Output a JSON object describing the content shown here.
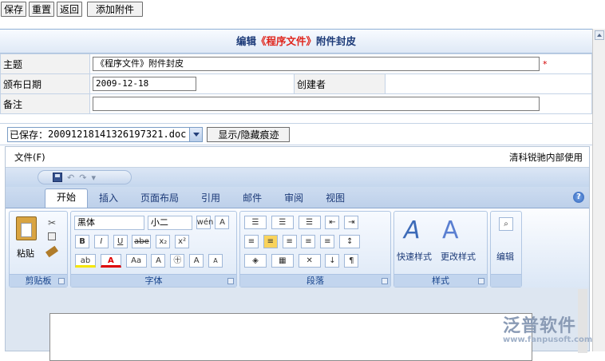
{
  "toolbar": {
    "save": "保存",
    "reset": "重置",
    "back": "返回",
    "attach": "添加附件"
  },
  "header": {
    "title_pre": "编辑",
    "title_hl": "《程序文件》",
    "title_post": "附件封皮"
  },
  "form": {
    "subject_label": "主题",
    "subject_value": "《程序文件》附件封皮",
    "required_mark": "*",
    "date_label": "颁布日期",
    "date_value": "2009-12-18",
    "creator_label": "创建者",
    "creator_value": "",
    "note_label": "备注",
    "note_value": ""
  },
  "saved": {
    "label": "已保存：",
    "file": "20091218141326197321.doc",
    "toggle_label": "显示/隐藏痕迹"
  },
  "doc": {
    "menu_file": "文件(F)",
    "menu_right": "清科锐驰内部使用",
    "qat_undo": "↶",
    "qat_redo": "↷",
    "qat_more": "▾",
    "tabs": [
      {
        "label": "开始"
      },
      {
        "label": "插入"
      },
      {
        "label": "页面布局"
      },
      {
        "label": "引用"
      },
      {
        "label": "邮件"
      },
      {
        "label": "审阅"
      },
      {
        "label": "视图"
      }
    ],
    "help": "?",
    "groups": {
      "clipboard": {
        "label": "剪贴板",
        "paste": "粘贴"
      },
      "font": {
        "label": "字体",
        "font_name": "黑体",
        "font_size": "小二",
        "b": "B",
        "i": "I",
        "u": "U",
        "strike": "abe",
        "sub": "x₂",
        "sup": "x²",
        "aa": "Aa",
        "grow": "A",
        "shrink": "A",
        "phon": "wén",
        "box": "A",
        "circle": "㊉",
        "highlight": "ab",
        "color": "A"
      },
      "paragraph": {
        "label": "段落"
      },
      "styles": {
        "label": "样式",
        "quick": "快速样式",
        "change": "更改样式"
      },
      "editing": {
        "label": "",
        "edit": "编辑"
      }
    }
  },
  "watermark": {
    "big": "泛普软件",
    "small": "www.fanpusoft.com"
  }
}
